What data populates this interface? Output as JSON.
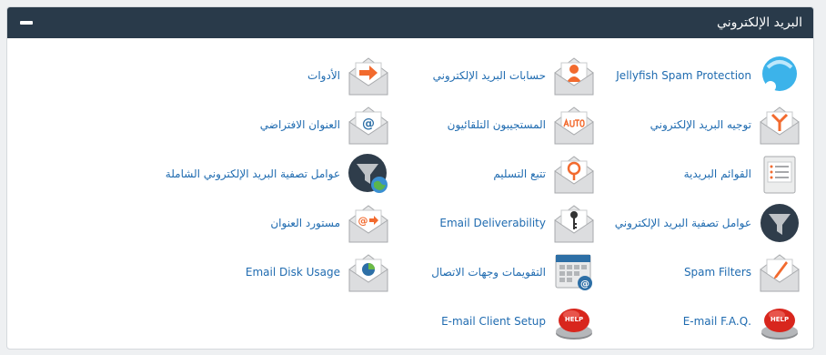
{
  "panel": {
    "title": "البريد الإلكتروني",
    "header_color": "#293a4a"
  },
  "items": [
    {
      "label": "Jellyfish Spam Protection",
      "icon": "jellyfish-icon"
    },
    {
      "label": "حسابات البريد الإلكتروني",
      "icon": "email-accounts-icon"
    },
    {
      "label": "الأدوات",
      "icon": "forwarders-arrow-icon"
    },
    {
      "label": "توجيه البريد الإلكتروني",
      "icon": "email-routing-icon"
    },
    {
      "label": "المستجيبون التلقائيون",
      "icon": "autoresponder-icon"
    },
    {
      "label": "العنوان الافتراضي",
      "icon": "default-address-icon"
    },
    {
      "label": "القوائم البريدية",
      "icon": "mailing-lists-icon"
    },
    {
      "label": "تتبع التسليم",
      "icon": "track-delivery-icon"
    },
    {
      "label": "عوامل تصفية البريد الإلكتروني الشاملة",
      "icon": "global-filter-icon"
    },
    {
      "label": "عوامل تصفية البريد الإلكتروني",
      "icon": "email-filter-icon"
    },
    {
      "label": "Email Deliverability",
      "icon": "deliverability-key-icon"
    },
    {
      "label": "مستورد العنوان",
      "icon": "address-importer-icon"
    },
    {
      "label": "Spam Filters",
      "icon": "spam-filters-icon"
    },
    {
      "label": "التقويمات وجهات الاتصال",
      "icon": "calendar-contacts-icon"
    },
    {
      "label": "Email Disk Usage",
      "icon": "disk-usage-icon"
    },
    {
      "label": "E-mail F.A.Q.",
      "icon": "help-faq-icon"
    },
    {
      "label": "E-mail Client Setup",
      "icon": "help-client-setup-icon"
    }
  ]
}
